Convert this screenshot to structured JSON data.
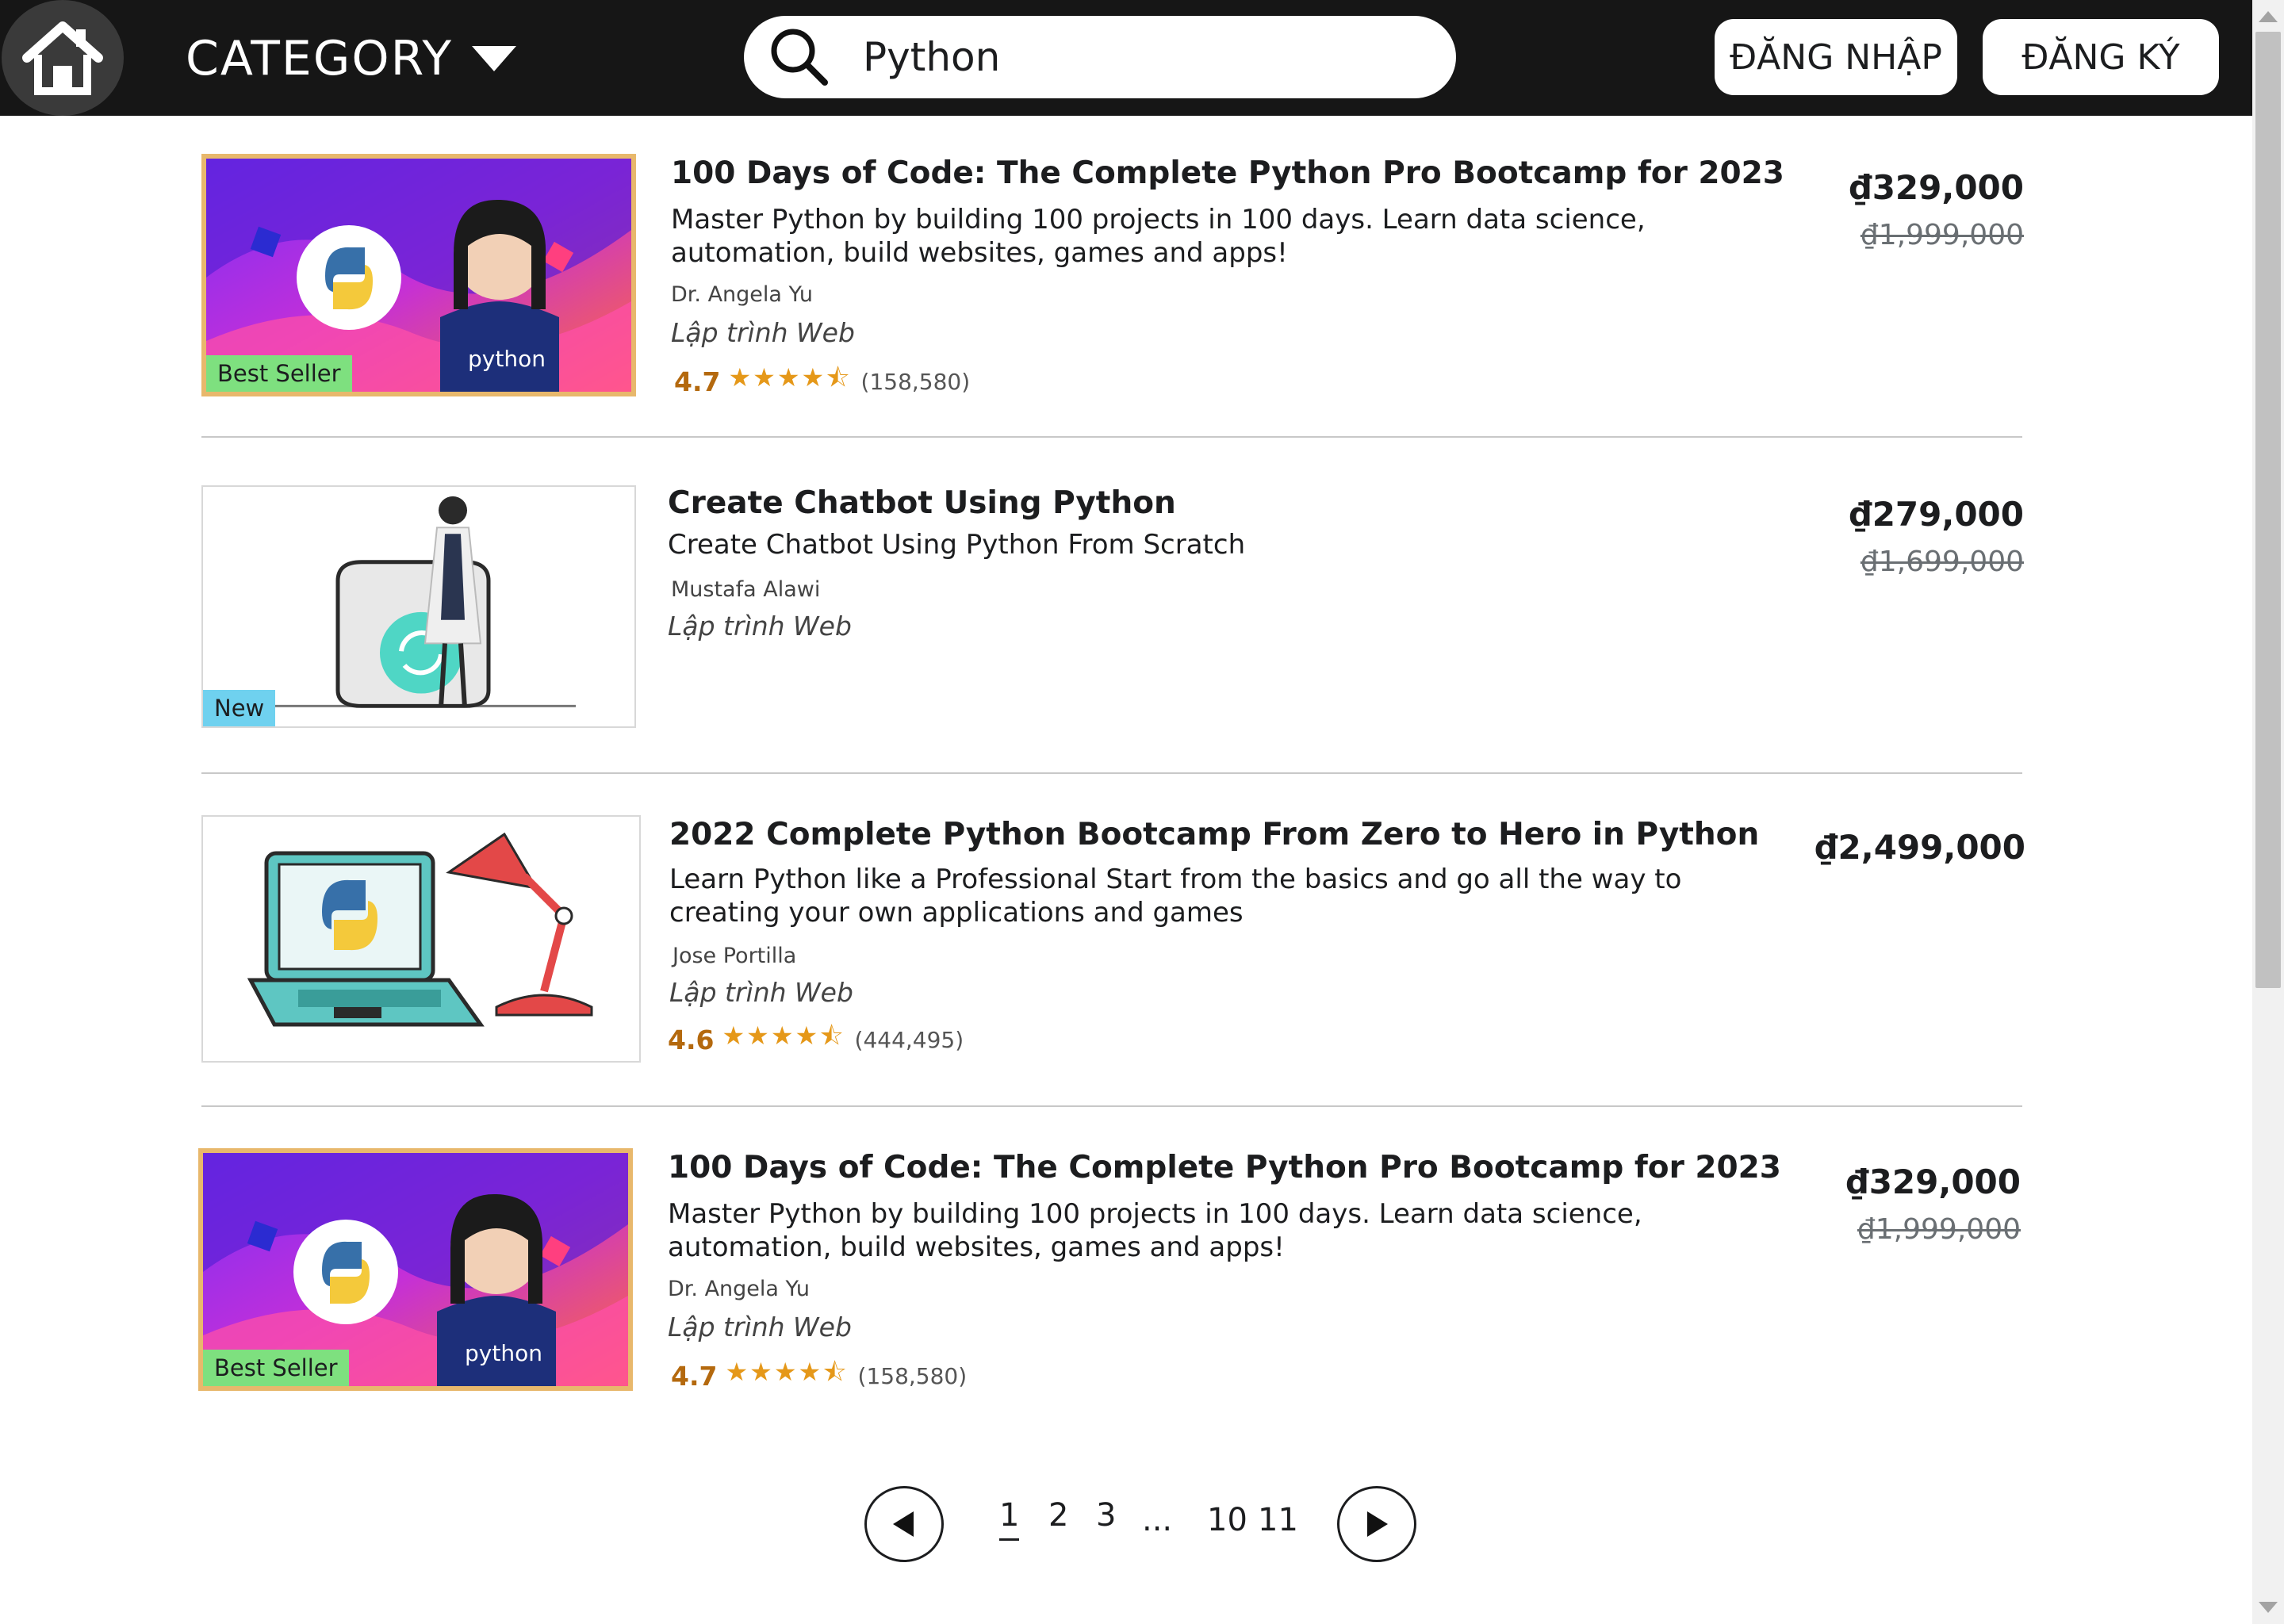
{
  "header": {
    "category_label": "CATEGORY",
    "search_value": "Python",
    "login_label": "ĐĂNG NHẬP",
    "register_label": "ĐĂNG KÝ"
  },
  "courses": [
    {
      "title": "100 Days of Code: The Complete Python Pro Bootcamp for 2023",
      "description": "Master Python by building 100 projects in 100 days. Learn data science, automation, build websites, games and apps!",
      "author": "Dr. Angela Yu",
      "category": "Lập trình Web",
      "rating": "4.7",
      "rating_count": "(158,580)",
      "price": "₫329,000",
      "old_price": "₫1,999,000",
      "badge": "Best Seller",
      "thumb_text": "python"
    },
    {
      "title": "Create Chatbot Using Python",
      "description": "Create Chatbot Using Python From Scratch",
      "author": "Mustafa Alawi",
      "category": "Lập trình Web",
      "price": "₫279,000",
      "old_price": "₫1,699,000",
      "badge": "New"
    },
    {
      "title": "2022 Complete Python Bootcamp From Zero to Hero in Python",
      "description": "Learn Python like a Professional Start from the basics and go all the way to creating your own applications and games",
      "author": "Jose Portilla",
      "category": "Lập trình Web",
      "rating": "4.6",
      "rating_count": "(444,495)",
      "price": "₫2,499,000"
    },
    {
      "title": "100 Days of Code: The Complete Python Pro Bootcamp for 2023",
      "description": "Master Python by building 100 projects in 100 days. Learn data science, automation, build websites, games and apps!",
      "author": "Dr. Angela Yu",
      "category": "Lập trình Web",
      "rating": "4.7",
      "rating_count": "(158,580)",
      "price": "₫329,000",
      "old_price": "₫1,999,000",
      "badge": "Best Seller",
      "thumb_text": "python"
    }
  ],
  "pagination": {
    "pages": [
      "1",
      "2",
      "3",
      "...",
      "10",
      "11"
    ],
    "current": "1"
  },
  "colors": {
    "header_bg": "#161616",
    "rating": "#b4690e",
    "stars": "#e59819",
    "best_seller_badge": "#7ee07f",
    "new_badge": "#6fd1ef"
  },
  "icons": {
    "home": "home-icon",
    "caret": "caret-down-icon",
    "search": "search-icon",
    "prev": "prev-arrow-icon",
    "next": "next-arrow-icon",
    "star": "star-icon"
  }
}
